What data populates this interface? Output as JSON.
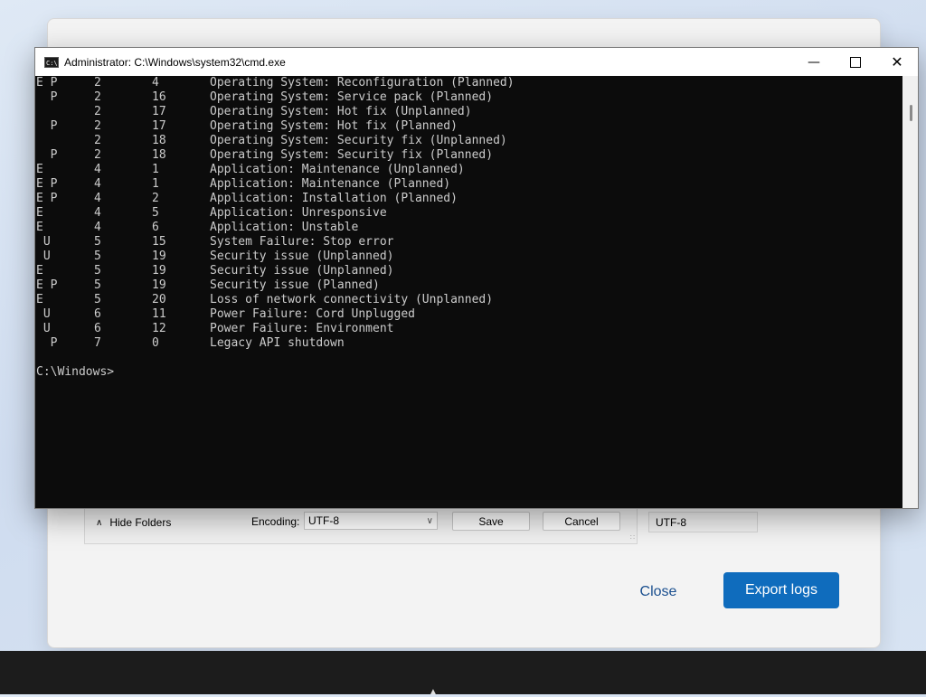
{
  "cmd": {
    "title": "Administrator: C:\\Windows\\system32\\cmd.exe",
    "icon": "C:\\",
    "rows": [
      {
        "flags": "E P",
        "major": "2",
        "minor": "4",
        "reason": "Operating System: Reconfiguration (Planned)"
      },
      {
        "flags": "  P",
        "major": "2",
        "minor": "16",
        "reason": "Operating System: Service pack (Planned)"
      },
      {
        "flags": "",
        "major": "2",
        "minor": "17",
        "reason": "Operating System: Hot fix (Unplanned)"
      },
      {
        "flags": "  P",
        "major": "2",
        "minor": "17",
        "reason": "Operating System: Hot fix (Planned)"
      },
      {
        "flags": "",
        "major": "2",
        "minor": "18",
        "reason": "Operating System: Security fix (Unplanned)"
      },
      {
        "flags": "  P",
        "major": "2",
        "minor": "18",
        "reason": "Operating System: Security fix (Planned)"
      },
      {
        "flags": "E",
        "major": "4",
        "minor": "1",
        "reason": "Application: Maintenance (Unplanned)"
      },
      {
        "flags": "E P",
        "major": "4",
        "minor": "1",
        "reason": "Application: Maintenance (Planned)"
      },
      {
        "flags": "E P",
        "major": "4",
        "minor": "2",
        "reason": "Application: Installation (Planned)"
      },
      {
        "flags": "E",
        "major": "4",
        "minor": "5",
        "reason": "Application: Unresponsive"
      },
      {
        "flags": "E",
        "major": "4",
        "minor": "6",
        "reason": "Application: Unstable"
      },
      {
        "flags": " U",
        "major": "5",
        "minor": "15",
        "reason": "System Failure: Stop error"
      },
      {
        "flags": " U",
        "major": "5",
        "minor": "19",
        "reason": "Security issue (Unplanned)"
      },
      {
        "flags": "E",
        "major": "5",
        "minor": "19",
        "reason": "Security issue (Unplanned)"
      },
      {
        "flags": "E P",
        "major": "5",
        "minor": "19",
        "reason": "Security issue (Planned)"
      },
      {
        "flags": "E",
        "major": "5",
        "minor": "20",
        "reason": "Loss of network connectivity (Unplanned)"
      },
      {
        "flags": " U",
        "major": "6",
        "minor": "11",
        "reason": "Power Failure: Cord Unplugged"
      },
      {
        "flags": " U",
        "major": "6",
        "minor": "12",
        "reason": "Power Failure: Environment"
      },
      {
        "flags": "  P",
        "major": "7",
        "minor": "0",
        "reason": "Legacy API shutdown"
      }
    ],
    "prompt": "C:\\Windows>"
  },
  "save_dialog": {
    "hide_folders": "Hide Folders",
    "encoding_label": "Encoding:",
    "encoding_value": "UTF-8",
    "save": "Save",
    "cancel": "Cancel",
    "encoding_value_2": "UTF-8"
  },
  "bg_dialog": {
    "close": "Close",
    "export": "Export logs"
  }
}
